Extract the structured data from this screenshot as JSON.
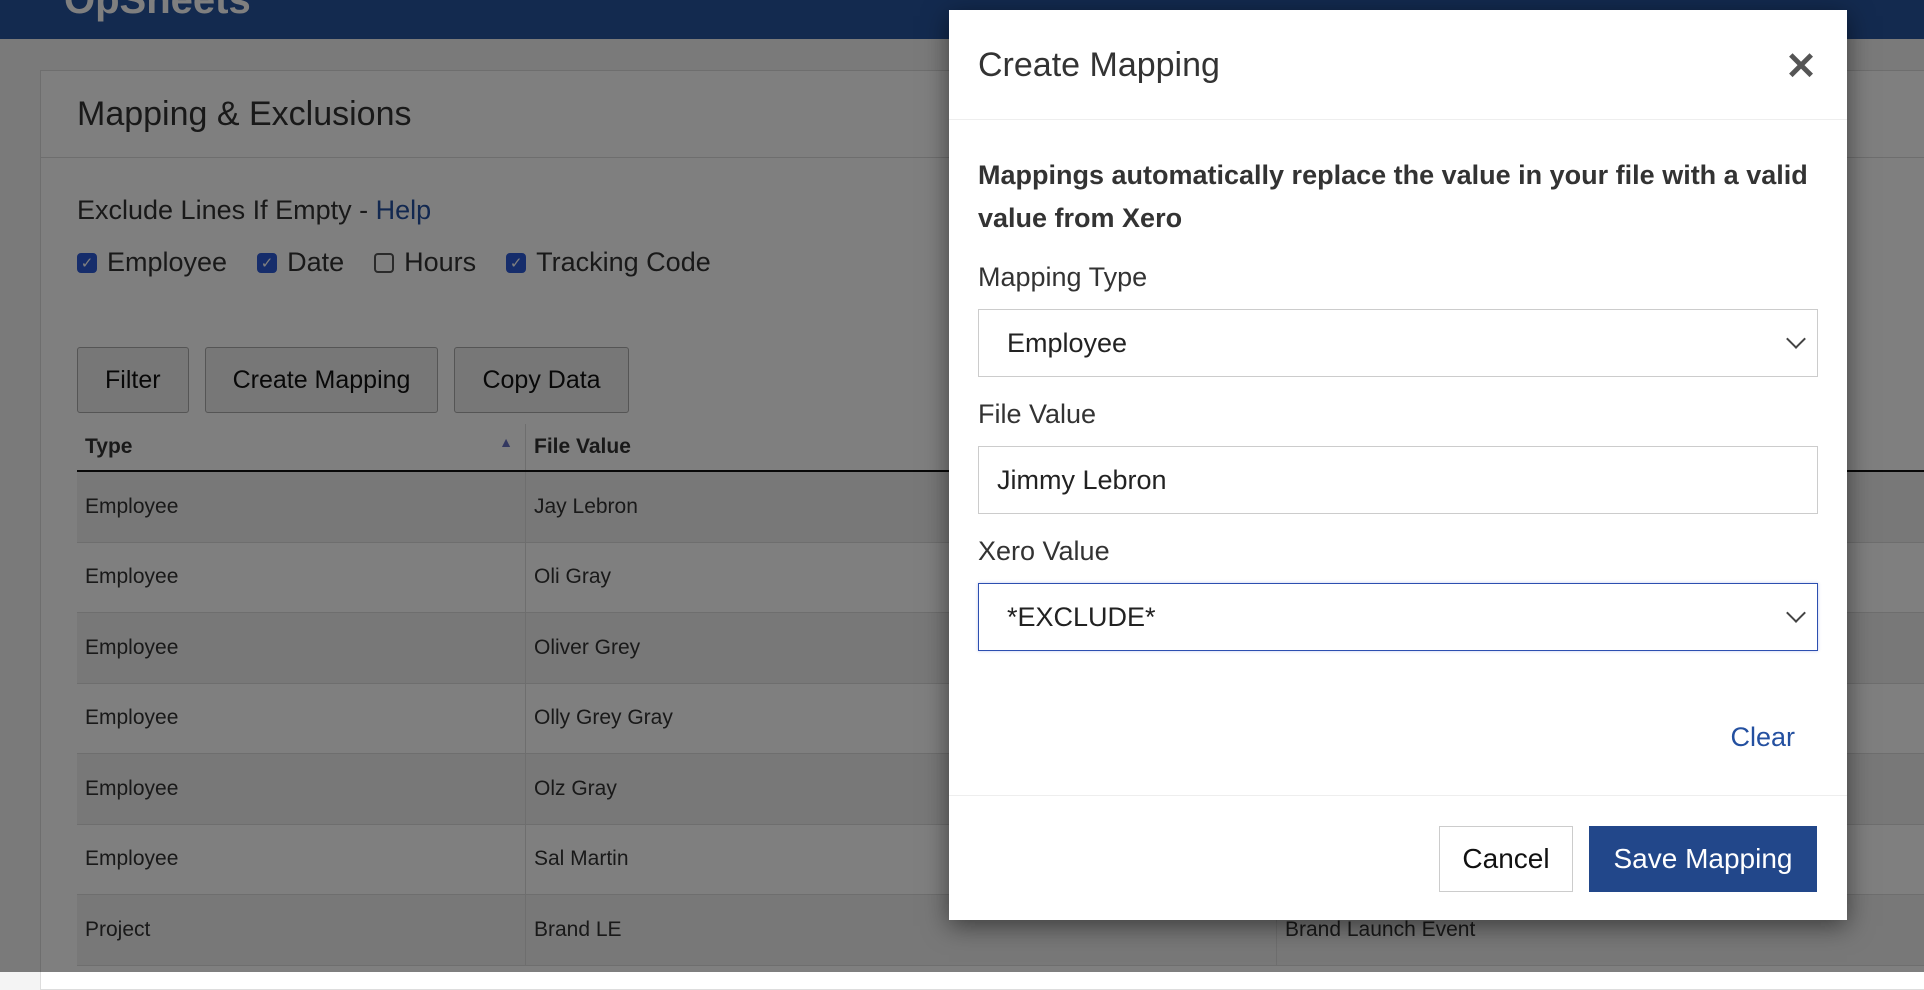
{
  "app": {
    "logo": "OpSheets"
  },
  "page": {
    "title": "Mapping & Exclusions",
    "exclude_label": "Exclude Lines If Empty - ",
    "help_link": "Help",
    "checkboxes": [
      {
        "label": "Employee",
        "checked": true
      },
      {
        "label": "Date",
        "checked": true
      },
      {
        "label": "Hours",
        "checked": false
      },
      {
        "label": "Tracking Code",
        "checked": true
      }
    ],
    "buttons": {
      "filter": "Filter",
      "create": "Create Mapping",
      "copy": "Copy Data"
    }
  },
  "table": {
    "headers": [
      "Type",
      "File Value",
      ""
    ],
    "rows": [
      [
        "Employee",
        "Jay Lebron",
        ""
      ],
      [
        "Employee",
        "Oli Gray",
        ""
      ],
      [
        "Employee",
        "Oliver Grey",
        ""
      ],
      [
        "Employee",
        "Olly Grey Gray",
        ""
      ],
      [
        "Employee",
        "Olz Gray",
        ""
      ],
      [
        "Employee",
        "Sal Martin",
        ""
      ],
      [
        "Project",
        "Brand LE",
        "Brand Launch Event"
      ]
    ]
  },
  "modal": {
    "title": "Create Mapping",
    "intro": "Mappings automatically replace the value in your file with a valid value from Xero",
    "mapping_type_label": "Mapping Type",
    "mapping_type_value": "Employee",
    "file_value_label": "File Value",
    "file_value": "Jimmy Lebron",
    "xero_value_label": "Xero Value",
    "xero_value": "*EXCLUDE*",
    "clear": "Clear",
    "cancel": "Cancel",
    "save": "Save Mapping"
  },
  "colors": {
    "brand": "#22478a",
    "link": "#2450a0"
  }
}
